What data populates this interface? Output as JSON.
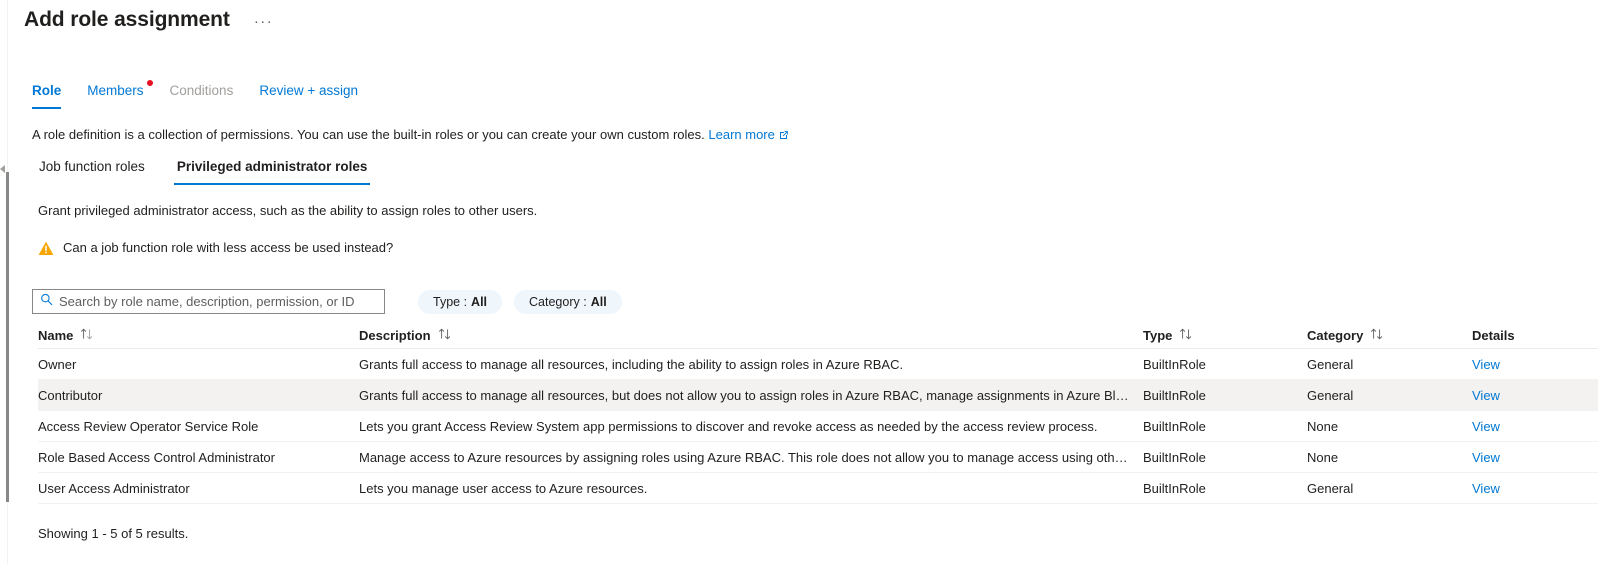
{
  "header": {
    "title": "Add role assignment",
    "more_menu": "···",
    "more_menu_name": "more-options"
  },
  "wizard_tabs": [
    {
      "label": "Role",
      "state": "selected",
      "badge": false
    },
    {
      "label": "Members",
      "state": "link",
      "badge": true
    },
    {
      "label": "Conditions",
      "state": "disabled",
      "badge": false
    },
    {
      "label": "Review + assign",
      "state": "link",
      "badge": false
    }
  ],
  "intro": {
    "text": "A role definition is a collection of permissions. You can use the built-in roles or you can create your own custom roles.",
    "link_label": "Learn more"
  },
  "subtabs": [
    {
      "label": "Job function roles",
      "selected": false
    },
    {
      "label": "Privileged administrator roles",
      "selected": true
    }
  ],
  "body_description": "Grant privileged administrator access, such as the ability to assign roles to other users.",
  "warning": {
    "icon": "warning-triangle-icon",
    "text": "Can a job function role with less access be used instead?",
    "color": "#f7a600"
  },
  "search": {
    "placeholder": "Search by role name, description, permission, or ID",
    "value": "",
    "icon": "search-icon"
  },
  "filters": [
    {
      "label": "Type :",
      "value": "All"
    },
    {
      "label": "Category :",
      "value": "All"
    }
  ],
  "table": {
    "columns": [
      {
        "label": "Name",
        "sortable": true
      },
      {
        "label": "Description",
        "sortable": true
      },
      {
        "label": "Type",
        "sortable": true
      },
      {
        "label": "Category",
        "sortable": true
      },
      {
        "label": "Details",
        "sortable": false
      }
    ],
    "rows": [
      {
        "name": "Owner",
        "description": "Grants full access to manage all resources, including the ability to assign roles in Azure RBAC.",
        "type": "BuiltInRole",
        "category": "General",
        "details": "View"
      },
      {
        "name": "Contributor",
        "description": "Grants full access to manage all resources, but does not allow you to assign roles in Azure RBAC, manage assignments in Azure Blueprint...",
        "type": "BuiltInRole",
        "category": "General",
        "details": "View"
      },
      {
        "name": "Access Review Operator Service Role",
        "description": "Lets you grant Access Review System app permissions to discover and revoke access as needed by the access review process.",
        "type": "BuiltInRole",
        "category": "None",
        "details": "View"
      },
      {
        "name": "Role Based Access Control Administrator",
        "description": "Manage access to Azure resources by assigning roles using Azure RBAC. This role does not allow you to manage access using other ways,...",
        "type": "BuiltInRole",
        "category": "None",
        "details": "View"
      },
      {
        "name": "User Access Administrator",
        "description": "Lets you manage user access to Azure resources.",
        "type": "BuiltInRole",
        "category": "General",
        "details": "View"
      }
    ],
    "selected_row_index": 1
  },
  "footer": {
    "results_text": "Showing 1 - 5 of 5 results."
  },
  "colors": {
    "accent": "#0078d4",
    "badge_red": "#e81123",
    "warning_orange": "#f7a600",
    "row_selected": "#f3f2f1",
    "pill_bg": "#eff6fc"
  }
}
